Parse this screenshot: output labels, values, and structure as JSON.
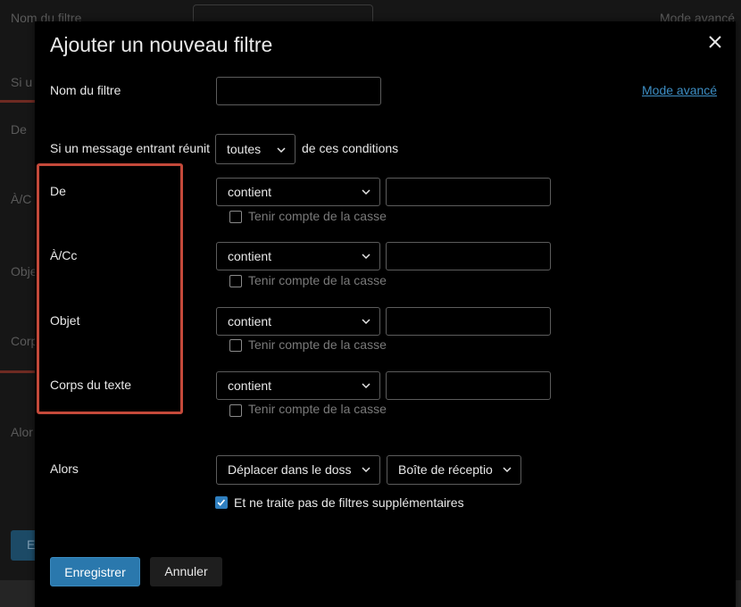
{
  "background": {
    "filter_name_label": "Nom du filtre",
    "mode_link": "Mode avancé",
    "if_label": "Si u",
    "rows": [
      "De",
      "À/C",
      "Obje",
      "Corp"
    ],
    "then_label": "Alor",
    "save_fragment": "E"
  },
  "dialog": {
    "title": "Ajouter un nouveau filtre",
    "filter_name_label": "Nom du filtre",
    "filter_name_value": "",
    "advanced_mode_link": "Mode avancé",
    "condition_prefix": "Si un message entrant réunit",
    "condition_match": "toutes",
    "condition_suffix": "de ces conditions",
    "criteria": [
      {
        "label": "De",
        "operator": "contient",
        "value": "",
        "case_label": "Tenir compte de la casse",
        "case_checked": false
      },
      {
        "label": "À/Cc",
        "operator": "contient",
        "value": "",
        "case_label": "Tenir compte de la casse",
        "case_checked": false
      },
      {
        "label": "Objet",
        "operator": "contient",
        "value": "",
        "case_label": "Tenir compte de la casse",
        "case_checked": false
      },
      {
        "label": "Corps du texte",
        "operator": "contient",
        "value": "",
        "case_label": "Tenir compte de la casse",
        "case_checked": false
      }
    ],
    "then_label": "Alors",
    "action": "Déplacer dans le doss",
    "destination": "Boîte de réceptio",
    "stop_label": "Et ne traite pas de filtres supplémentaires",
    "stop_checked": true,
    "save_label": "Enregistrer",
    "cancel_label": "Annuler"
  },
  "colors": {
    "accent": "#2a78ad",
    "link": "#3d8ec4",
    "highlight": "#c4493a"
  }
}
